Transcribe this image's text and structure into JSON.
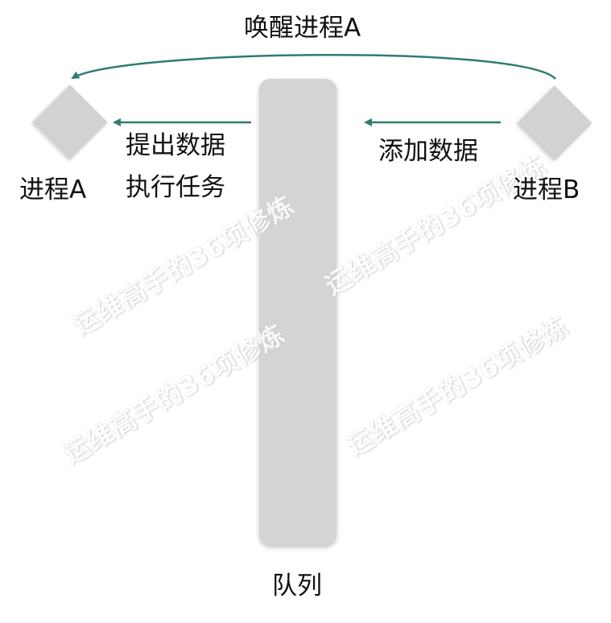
{
  "nodes": {
    "process_a": "进程A",
    "process_b": "进程B"
  },
  "queue": {
    "label": "队列"
  },
  "edges": {
    "wake": "唤醒进程A",
    "add_data": "添加数据",
    "fetch_line1": "提出数据",
    "fetch_line2": "执行任务"
  },
  "watermark": {
    "text": "运维高手的36项修炼"
  },
  "colors": {
    "arrow": "#2e7d6f",
    "node_fill": "#d2d2d2",
    "queue_fill": "#d4d4d4"
  }
}
